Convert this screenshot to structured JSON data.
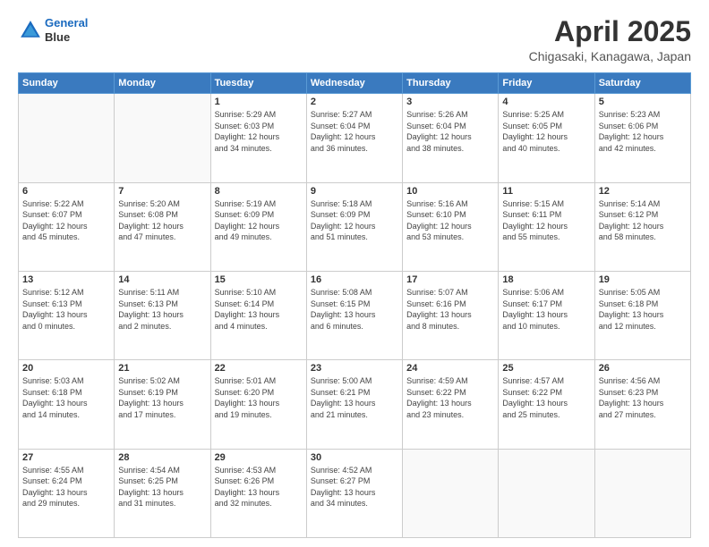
{
  "header": {
    "logo_line1": "General",
    "logo_line2": "Blue",
    "month_year": "April 2025",
    "location": "Chigasaki, Kanagawa, Japan"
  },
  "weekdays": [
    "Sunday",
    "Monday",
    "Tuesday",
    "Wednesday",
    "Thursday",
    "Friday",
    "Saturday"
  ],
  "weeks": [
    [
      {
        "day": "",
        "info": ""
      },
      {
        "day": "",
        "info": ""
      },
      {
        "day": "1",
        "info": "Sunrise: 5:29 AM\nSunset: 6:03 PM\nDaylight: 12 hours\nand 34 minutes."
      },
      {
        "day": "2",
        "info": "Sunrise: 5:27 AM\nSunset: 6:04 PM\nDaylight: 12 hours\nand 36 minutes."
      },
      {
        "day": "3",
        "info": "Sunrise: 5:26 AM\nSunset: 6:04 PM\nDaylight: 12 hours\nand 38 minutes."
      },
      {
        "day": "4",
        "info": "Sunrise: 5:25 AM\nSunset: 6:05 PM\nDaylight: 12 hours\nand 40 minutes."
      },
      {
        "day": "5",
        "info": "Sunrise: 5:23 AM\nSunset: 6:06 PM\nDaylight: 12 hours\nand 42 minutes."
      }
    ],
    [
      {
        "day": "6",
        "info": "Sunrise: 5:22 AM\nSunset: 6:07 PM\nDaylight: 12 hours\nand 45 minutes."
      },
      {
        "day": "7",
        "info": "Sunrise: 5:20 AM\nSunset: 6:08 PM\nDaylight: 12 hours\nand 47 minutes."
      },
      {
        "day": "8",
        "info": "Sunrise: 5:19 AM\nSunset: 6:09 PM\nDaylight: 12 hours\nand 49 minutes."
      },
      {
        "day": "9",
        "info": "Sunrise: 5:18 AM\nSunset: 6:09 PM\nDaylight: 12 hours\nand 51 minutes."
      },
      {
        "day": "10",
        "info": "Sunrise: 5:16 AM\nSunset: 6:10 PM\nDaylight: 12 hours\nand 53 minutes."
      },
      {
        "day": "11",
        "info": "Sunrise: 5:15 AM\nSunset: 6:11 PM\nDaylight: 12 hours\nand 55 minutes."
      },
      {
        "day": "12",
        "info": "Sunrise: 5:14 AM\nSunset: 6:12 PM\nDaylight: 12 hours\nand 58 minutes."
      }
    ],
    [
      {
        "day": "13",
        "info": "Sunrise: 5:12 AM\nSunset: 6:13 PM\nDaylight: 13 hours\nand 0 minutes."
      },
      {
        "day": "14",
        "info": "Sunrise: 5:11 AM\nSunset: 6:13 PM\nDaylight: 13 hours\nand 2 minutes."
      },
      {
        "day": "15",
        "info": "Sunrise: 5:10 AM\nSunset: 6:14 PM\nDaylight: 13 hours\nand 4 minutes."
      },
      {
        "day": "16",
        "info": "Sunrise: 5:08 AM\nSunset: 6:15 PM\nDaylight: 13 hours\nand 6 minutes."
      },
      {
        "day": "17",
        "info": "Sunrise: 5:07 AM\nSunset: 6:16 PM\nDaylight: 13 hours\nand 8 minutes."
      },
      {
        "day": "18",
        "info": "Sunrise: 5:06 AM\nSunset: 6:17 PM\nDaylight: 13 hours\nand 10 minutes."
      },
      {
        "day": "19",
        "info": "Sunrise: 5:05 AM\nSunset: 6:18 PM\nDaylight: 13 hours\nand 12 minutes."
      }
    ],
    [
      {
        "day": "20",
        "info": "Sunrise: 5:03 AM\nSunset: 6:18 PM\nDaylight: 13 hours\nand 14 minutes."
      },
      {
        "day": "21",
        "info": "Sunrise: 5:02 AM\nSunset: 6:19 PM\nDaylight: 13 hours\nand 17 minutes."
      },
      {
        "day": "22",
        "info": "Sunrise: 5:01 AM\nSunset: 6:20 PM\nDaylight: 13 hours\nand 19 minutes."
      },
      {
        "day": "23",
        "info": "Sunrise: 5:00 AM\nSunset: 6:21 PM\nDaylight: 13 hours\nand 21 minutes."
      },
      {
        "day": "24",
        "info": "Sunrise: 4:59 AM\nSunset: 6:22 PM\nDaylight: 13 hours\nand 23 minutes."
      },
      {
        "day": "25",
        "info": "Sunrise: 4:57 AM\nSunset: 6:22 PM\nDaylight: 13 hours\nand 25 minutes."
      },
      {
        "day": "26",
        "info": "Sunrise: 4:56 AM\nSunset: 6:23 PM\nDaylight: 13 hours\nand 27 minutes."
      }
    ],
    [
      {
        "day": "27",
        "info": "Sunrise: 4:55 AM\nSunset: 6:24 PM\nDaylight: 13 hours\nand 29 minutes."
      },
      {
        "day": "28",
        "info": "Sunrise: 4:54 AM\nSunset: 6:25 PM\nDaylight: 13 hours\nand 31 minutes."
      },
      {
        "day": "29",
        "info": "Sunrise: 4:53 AM\nSunset: 6:26 PM\nDaylight: 13 hours\nand 32 minutes."
      },
      {
        "day": "30",
        "info": "Sunrise: 4:52 AM\nSunset: 6:27 PM\nDaylight: 13 hours\nand 34 minutes."
      },
      {
        "day": "",
        "info": ""
      },
      {
        "day": "",
        "info": ""
      },
      {
        "day": "",
        "info": ""
      }
    ]
  ]
}
